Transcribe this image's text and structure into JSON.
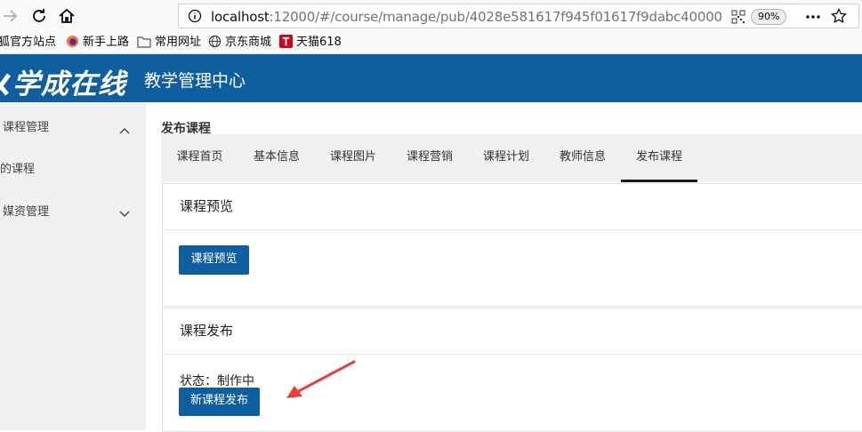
{
  "browser": {
    "url_host": "localhost",
    "url_rest": ":12000/#/course/manage/pub/4028e581617f945f01617f9dabc40000",
    "zoom": "90%",
    "bookmarks": [
      "狐官方站点",
      "新手上路",
      "常用网址",
      "京东商城",
      "天猫618"
    ]
  },
  "header": {
    "logo": "学成在线",
    "title": "教学管理中心"
  },
  "sidebar": {
    "items": [
      {
        "label": "课程管理"
      },
      {
        "label": "我的课程"
      },
      {
        "label": "媒资管理"
      }
    ]
  },
  "main": {
    "page_title": "发布课程",
    "tabs": [
      {
        "label": "课程首页"
      },
      {
        "label": "基本信息"
      },
      {
        "label": "课程图片"
      },
      {
        "label": "课程营销"
      },
      {
        "label": "课程计划"
      },
      {
        "label": "教师信息"
      },
      {
        "label": "发布课程"
      }
    ],
    "active_tab": "发布课程",
    "preview_panel": {
      "title": "课程预览",
      "button": "课程预览"
    },
    "publish_panel": {
      "title": "课程发布",
      "status": "状态：制作中",
      "button": "新课程发布"
    }
  },
  "colors": {
    "brand": "#0f5e9f",
    "annotation_arrow": "#e8403a"
  }
}
